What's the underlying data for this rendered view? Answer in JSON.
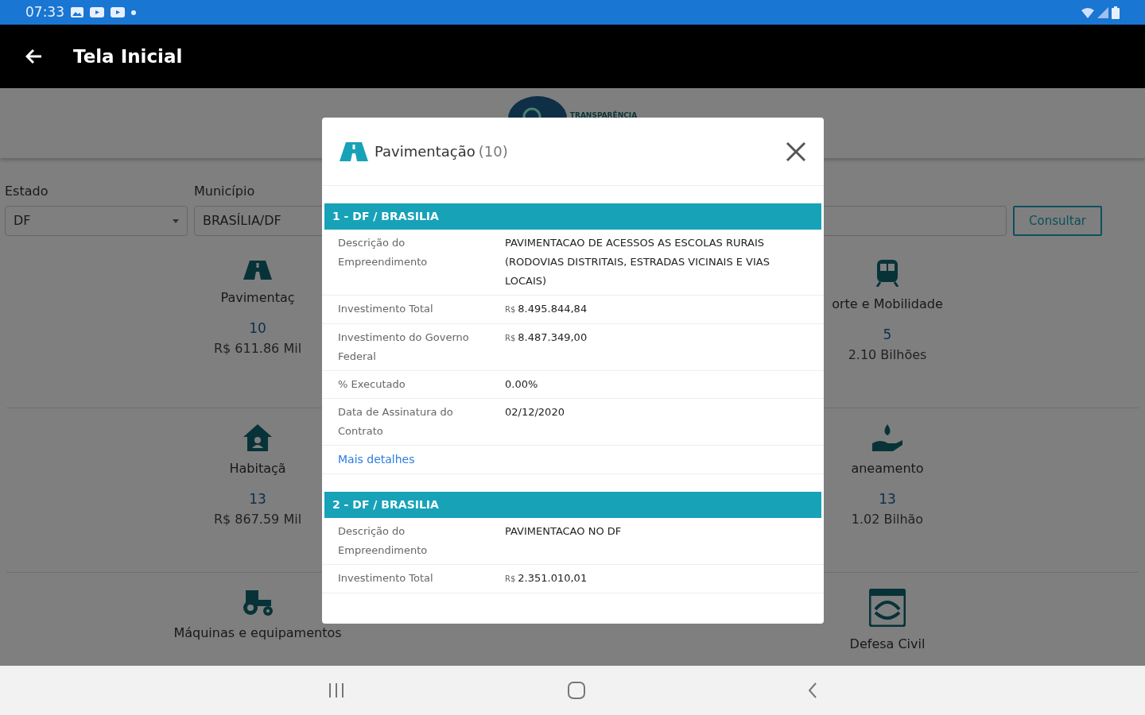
{
  "status_bar": {
    "time": "07:33"
  },
  "app_bar": {
    "title": "Tela Inicial"
  },
  "header": {
    "logo_text": "TRANSPARÊNCIA"
  },
  "filters": [
    {
      "label": "Estado",
      "value": "DF",
      "kind": "select"
    },
    {
      "label": "Município",
      "value": "BRASÍLIA/DF",
      "kind": "text"
    }
  ],
  "search_button": "Consultar",
  "categories": [
    {
      "name": "Pavimentaç",
      "count": "10",
      "amount": "R$ 611.86 Mil"
    },
    {
      "name": "orte e Mobilidade",
      "count": "5",
      "amount": "2.10 Bilhões"
    },
    {
      "name": "Habitaçã",
      "count": "13",
      "amount": "R$ 867.59 Mil"
    },
    {
      "name": "aneamento",
      "count": "13",
      "amount": "1.02 Bilhão"
    },
    {
      "name": "Máquinas e equipamentos"
    },
    {
      "name": "Defesa Civil"
    }
  ],
  "modal": {
    "title": "Pavimentação",
    "count": "(10)",
    "items": [
      {
        "heading": "1 - DF / BRASILIA",
        "fields": [
          {
            "label": "Descrição do Empreendimento",
            "value": "PAVIMENTACAO DE ACESSOS AS ESCOLAS RURAIS (RODOVIAS DISTRITAIS, ESTRADAS VICINAIS E VIAS LOCAIS)"
          },
          {
            "label": "Investimento Total",
            "currency": "R$",
            "value": "8.495.844,84"
          },
          {
            "label": "Investimento do Governo Federal",
            "currency": "R$",
            "value": "8.487.349,00"
          },
          {
            "label": "% Executado",
            "value": "0.00%"
          },
          {
            "label": "Data de Assinatura do Contrato",
            "value": "02/12/2020"
          }
        ],
        "link": "Mais detalhes"
      },
      {
        "heading": "2 - DF / BRASILIA",
        "fields": [
          {
            "label": "Descrição do Empreendimento",
            "value": "PAVIMENTACAO NO DF"
          },
          {
            "label": "Investimento Total",
            "currency": "R$",
            "value": "2.351.010,01"
          }
        ]
      }
    ]
  }
}
